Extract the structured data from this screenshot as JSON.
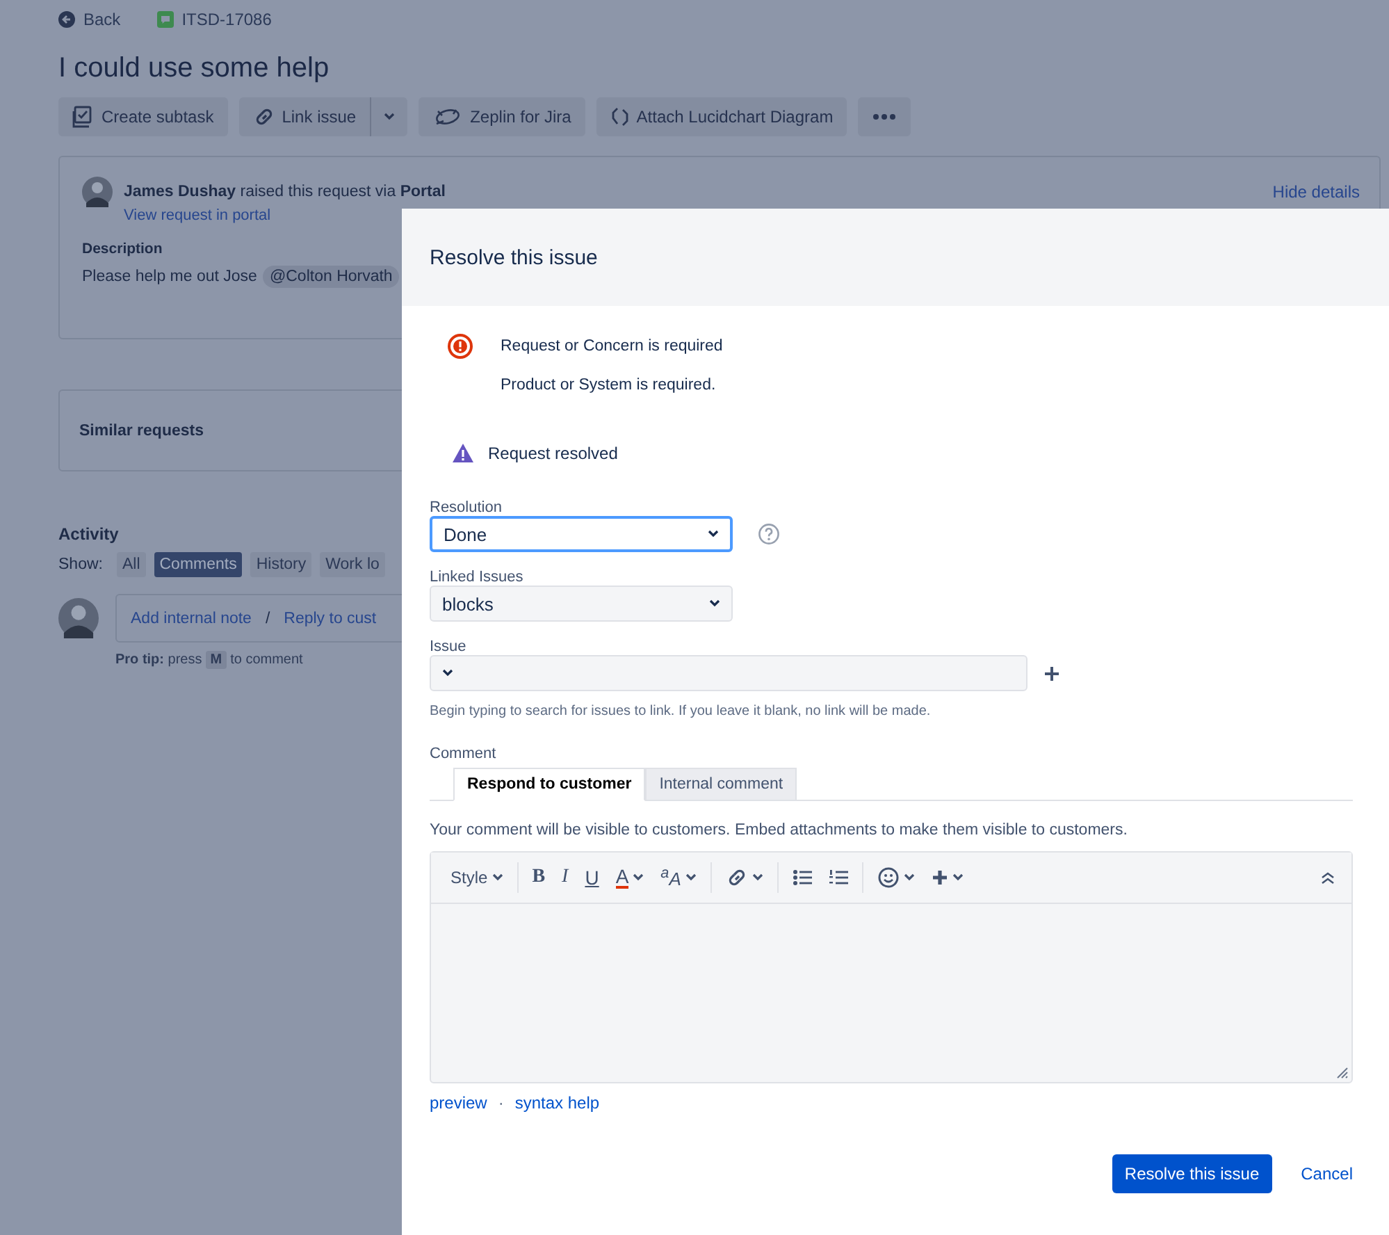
{
  "page": {
    "back_link": "Back",
    "issue_key": "ITSD-17086",
    "title": "I could use some help",
    "toolbar": [
      {
        "kind": "subtask",
        "label": "Create subtask"
      },
      {
        "kind": "link",
        "label": "Link issue"
      },
      {
        "kind": "dropdown"
      },
      {
        "kind": "zeplin",
        "label": "Zeplin for Jira"
      },
      {
        "kind": "lucidchart",
        "label": "Attach Lucidchart Diagram"
      },
      {
        "kind": "more"
      }
    ],
    "request": {
      "reporter": "James Dushay",
      "text": "raised this request via",
      "channel": "Portal",
      "portal_link": "View request in portal",
      "hide_details": "Hide details",
      "description_label": "Description",
      "description": "Please help me out Jose",
      "mention": "@Colton Horvath"
    },
    "similar_requests": "Similar requests",
    "activity": {
      "title": "Activity",
      "show_label": "Show:",
      "filters": [
        {
          "label": "All",
          "selected": false
        },
        {
          "label": "Comments",
          "selected": true
        },
        {
          "label": "History",
          "selected": false
        },
        {
          "label": "Work lo",
          "selected": false
        }
      ],
      "add_note": "Add internal note",
      "separator": "/",
      "reply": "Reply to cust",
      "pro_tip": "**Pro tip:** press",
      "key": "M",
      "pro_tip_end": "to comment"
    }
  },
  "dialog": {
    "title": "Resolve this issue",
    "errors": [
      "Request or Concern is required",
      "Product or System is required."
    ],
    "warning": "Request resolved",
    "resolution": {
      "label": "Resolution",
      "value": "Done",
      "focused": true
    },
    "linked_issues": {
      "label": "Linked Issues",
      "value": "blocks",
      "focused": false
    },
    "issue": {
      "label": "Issue",
      "hint": "Begin typing to search for issues to link. If you leave it blank, no link will be made."
    },
    "comment": {
      "label": "Comment",
      "tabs": [
        {
          "label": "Respond to customer",
          "selected": true
        },
        {
          "label": "Internal comment",
          "selected": false
        }
      ],
      "notice": "Your comment will be visible to customers. Embed attachments to make them visible to customers.",
      "toolbar": [
        {
          "kind": "style",
          "label": "Style"
        },
        {
          "kind": "separator"
        },
        {
          "kind": "bold",
          "label": "B"
        },
        {
          "kind": "italic",
          "label": "I"
        },
        {
          "kind": "underline",
          "label": "U"
        },
        {
          "kind": "color",
          "label": "A"
        },
        {
          "kind": "size",
          "label": "$^{a}$A"
        },
        {
          "kind": "separator"
        },
        {
          "kind": "link"
        },
        {
          "kind": "separator"
        },
        {
          "kind": "bullets"
        },
        {
          "kind": "numbers"
        },
        {
          "kind": "separator"
        },
        {
          "kind": "emoji"
        },
        {
          "kind": "insert"
        },
        {
          "kind": "collapse"
        }
      ],
      "links": [
        "preview",
        "syntax help"
      ],
      "link_separator": "·"
    },
    "buttons": {
      "primary": "Resolve this issue",
      "cancel": "Cancel"
    }
  }
}
